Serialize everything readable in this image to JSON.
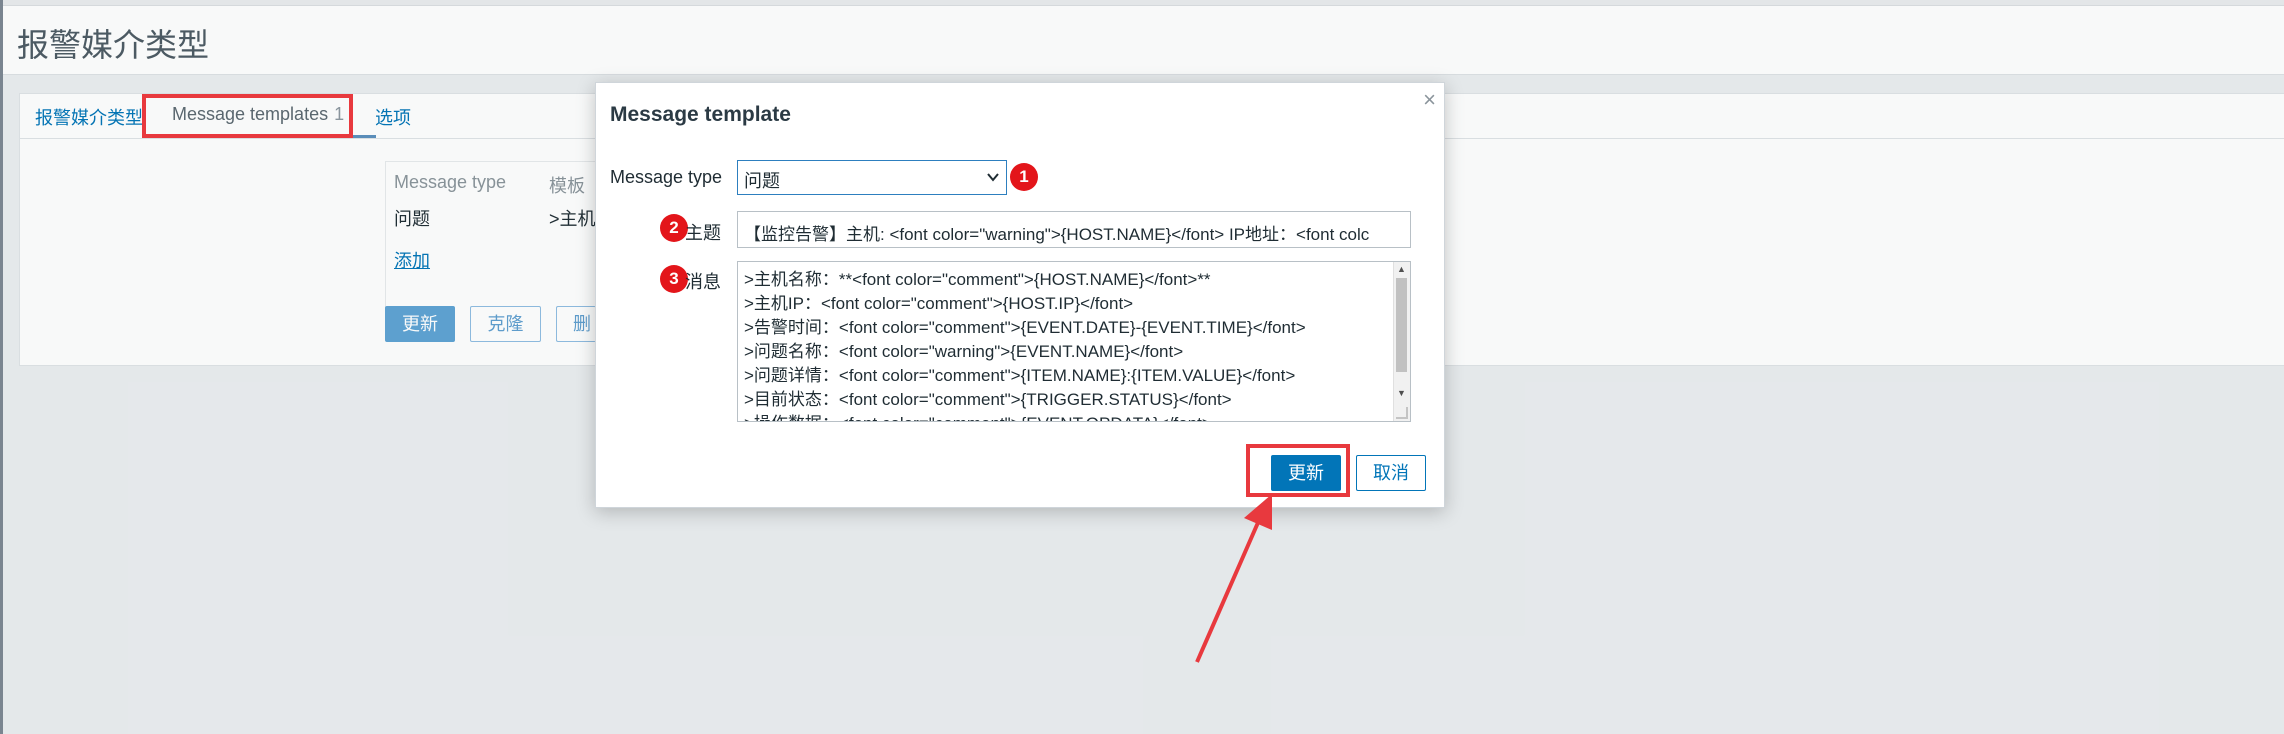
{
  "page": {
    "title": "报警媒介类型"
  },
  "tabs": [
    {
      "label": "报警媒介类型"
    },
    {
      "label": "Message templates",
      "count": "1"
    },
    {
      "label": "选项"
    }
  ],
  "templates_table": {
    "columns": [
      "Message type",
      "模板"
    ],
    "rows": [
      {
        "type": "问题",
        "template": ">主机"
      }
    ],
    "add_label": "添加"
  },
  "panel_buttons": {
    "update": "更新",
    "clone": "克隆",
    "delete": "删"
  },
  "dialog": {
    "title": "Message template",
    "close_icon": "×",
    "message_type_label": "Message type",
    "message_type_value": "问题",
    "subject_label": "主题",
    "subject_value": "【监控告警】主机: <font color=\"warning\">{HOST.NAME}</font>  IP地址：<font colc",
    "message_label": "消息",
    "message_lines": [
      ">主机名称：**<font color=\"comment\">{HOST.NAME}</font>**",
      ">主机IP：<font color=\"comment\">{HOST.IP}</font>",
      ">告警时间：<font color=\"comment\">{EVENT.DATE}-{EVENT.TIME}</font>",
      ">问题名称：<font color=\"warning\">{EVENT.NAME}</font>",
      ">问题详情：<font color=\"comment\">{ITEM.NAME}:{ITEM.VALUE}</font>",
      ">目前状态：<font color=\"comment\">{TRIGGER.STATUS}</font>",
      ">操作数据：<font color=\"comment\">{EVENT.OPDATA}</font>"
    ],
    "update_label": "更新",
    "cancel_label": "取消"
  },
  "annotations": {
    "markers": [
      "1",
      "2",
      "3"
    ],
    "highlight_color": "#e8393e"
  },
  "colors": {
    "primary": "#0275b8",
    "highlight": "#e3151a"
  }
}
